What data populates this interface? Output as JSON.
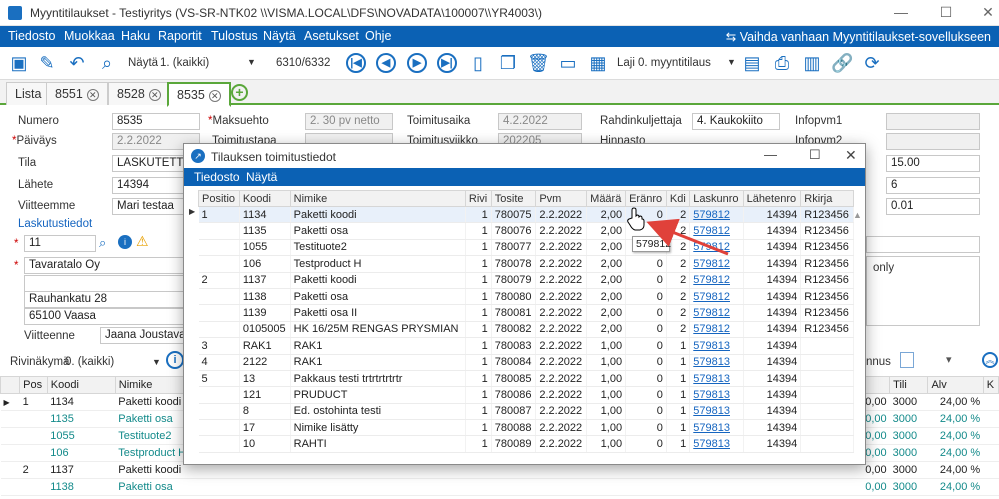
{
  "window": {
    "title": "Myyntitilaukset - Testiyritys (VS-SR-NTK02 \\\\VISMA.LOCAL\\DFS\\NOVADATA\\100007\\\\YR4003\\)"
  },
  "menu": [
    "Tiedosto",
    "Muokkaa",
    "Haku",
    "Raportit",
    "Tulostus",
    "Näytä",
    "Asetukset",
    "Ohje"
  ],
  "switch_link": "Vaihda vanhaan Myyntitilaukset-sovellukseen",
  "toolbar": {
    "view_label": "Näytä",
    "view_value": "1. (kaikki)",
    "counter": "6310/6332",
    "type_label": "Laji",
    "type_value": "0. myyntitilaus"
  },
  "tabs": [
    "Lista",
    "8551",
    "8528",
    "8535"
  ],
  "form": {
    "numero_label": "Numero",
    "numero": "8535",
    "paivays_label": "Päiväys",
    "paivays": "2.2.2022",
    "tila_label": "Tila",
    "tila": "LASKUTETTU",
    "lahete_label": "Lähete",
    "lahete": "14394",
    "viitteemme_label": "Viitteemme",
    "viitteemme": "Mari testaa",
    "laskutustiedot": "Laskutustiedot",
    "customer_no": "11",
    "customer_name": "Tavaratalo Oy",
    "address": "Rauhankatu 28",
    "postal": "65100 Vaasa",
    "viitteenne_label": "Viitteenne",
    "viitteenne": "Jaana Joustava",
    "maksuehto_label": "Maksuehto",
    "maksuehto": "2. 30 pv netto",
    "toimitustapa_label": "Toimitustapa",
    "toimitusaika_label": "Toimitusaika",
    "toimitusaika": "4.2.2022",
    "toimitusviikko_label": "Toimitusviikko",
    "toimitusviikko": "202205",
    "rahdinkuljettaja_label": "Rahdinkuljettaja",
    "rahdinkuljettaja": "4. Kaukokiito",
    "hinnasto_label": "Hinnasto",
    "infopvm1_label": "Infopvm1",
    "infopvm2_label": "Infopvm2",
    "right_val1": "15.00",
    "right_val2": "6",
    "right_val3": "0.01",
    "only_text": "only"
  },
  "dialog": {
    "title": "Tilauksen toimitustiedot",
    "menu": [
      "Tiedosto",
      "Näytä"
    ],
    "columns": [
      "Positio",
      "Koodi",
      "Nimike",
      "Rivi",
      "Tosite",
      "Pvm",
      "Määrä",
      "Eränro",
      "Kdi",
      "Laskunro",
      "Lähetenro",
      "Rkirja"
    ],
    "rows": [
      [
        "1",
        "1134",
        "Paketti koodi",
        "1",
        "780075",
        "2.2.2022",
        "2,00",
        "0",
        "2",
        "579812",
        "14394",
        "R123456"
      ],
      [
        "",
        "1135",
        "Paketti osa",
        "1",
        "780076",
        "2.2.2022",
        "2,00",
        "0",
        "2",
        "579812",
        "14394",
        "R123456"
      ],
      [
        "",
        "1055",
        "Testituote2",
        "1",
        "780077",
        "2.2.2022",
        "2,00",
        "0",
        "2",
        "579812",
        "14394",
        "R123456"
      ],
      [
        "",
        "106",
        "Testproduct H",
        "1",
        "780078",
        "2.2.2022",
        "2,00",
        "0",
        "2",
        "579812",
        "14394",
        "R123456"
      ],
      [
        "2",
        "1137",
        "Paketti koodi",
        "1",
        "780079",
        "2.2.2022",
        "2,00",
        "0",
        "2",
        "579812",
        "14394",
        "R123456"
      ],
      [
        "",
        "1138",
        "Paketti osa",
        "1",
        "780080",
        "2.2.2022",
        "2,00",
        "0",
        "2",
        "579812",
        "14394",
        "R123456"
      ],
      [
        "",
        "1139",
        "Paketti osa II",
        "1",
        "780081",
        "2.2.2022",
        "2,00",
        "0",
        "2",
        "579812",
        "14394",
        "R123456"
      ],
      [
        "",
        "0105005",
        "HK 16/25M RENGAS PRYSMIAN",
        "1",
        "780082",
        "2.2.2022",
        "2,00",
        "0",
        "2",
        "579812",
        "14394",
        "R123456"
      ],
      [
        "3",
        "RAK1",
        "RAK1",
        "1",
        "780083",
        "2.2.2022",
        "1,00",
        "0",
        "1",
        "579813",
        "14394",
        ""
      ],
      [
        "4",
        "2122",
        "RAK1",
        "1",
        "780084",
        "2.2.2022",
        "1,00",
        "0",
        "1",
        "579813",
        "14394",
        ""
      ],
      [
        "5",
        "13",
        "Pakkaus testi trtrtrtrtrtr",
        "1",
        "780085",
        "2.2.2022",
        "1,00",
        "0",
        "1",
        "579813",
        "14394",
        ""
      ],
      [
        "",
        "121",
        "PRUDUCT",
        "1",
        "780086",
        "2.2.2022",
        "1,00",
        "0",
        "1",
        "579813",
        "14394",
        ""
      ],
      [
        "",
        "8",
        "Ed. ostohinta testi",
        "1",
        "780087",
        "2.2.2022",
        "1,00",
        "0",
        "1",
        "579813",
        "14394",
        ""
      ],
      [
        "",
        "17",
        "Nimike lisätty",
        "1",
        "780088",
        "2.2.2022",
        "1,00",
        "0",
        "1",
        "579813",
        "14394",
        ""
      ],
      [
        "",
        "10",
        "RAHTI",
        "1",
        "780089",
        "2.2.2022",
        "1,00",
        "0",
        "1",
        "579813",
        "14394",
        ""
      ]
    ],
    "tooltip": "579812"
  },
  "rowview": {
    "label": "Rivinäkymä",
    "value": "0. (kaikki)",
    "right_label": "nnus"
  },
  "bottom": {
    "columns": [
      "Pos",
      "Koodi",
      "Nimike"
    ],
    "right_columns": [
      "a",
      "Tili",
      "Alv",
      "K"
    ],
    "rows": [
      [
        "1",
        "1134",
        "Paketti koodi",
        "80,00",
        "3000",
        "24,00 %"
      ],
      [
        "",
        "1135",
        "Paketti osa",
        "0,00",
        "3000",
        "24,00 %"
      ],
      [
        "",
        "1055",
        "Testituote2",
        "0,00",
        "3000",
        "24,00 %"
      ],
      [
        "",
        "106",
        "Testproduct H",
        "0,00",
        "3000",
        "24,00 %"
      ],
      [
        "2",
        "1137",
        "Paketti koodi",
        "0,00",
        "3000",
        "24,00 %"
      ],
      [
        "",
        "1138",
        "Paketti osa",
        "0,00",
        "3000",
        "24,00 %"
      ]
    ]
  },
  "colors": {
    "menubar": "#0b61b4",
    "tab_active": "#5aa73a",
    "link": "#1565c0",
    "teal": "#138a8a",
    "arrow": "#e0413a"
  }
}
